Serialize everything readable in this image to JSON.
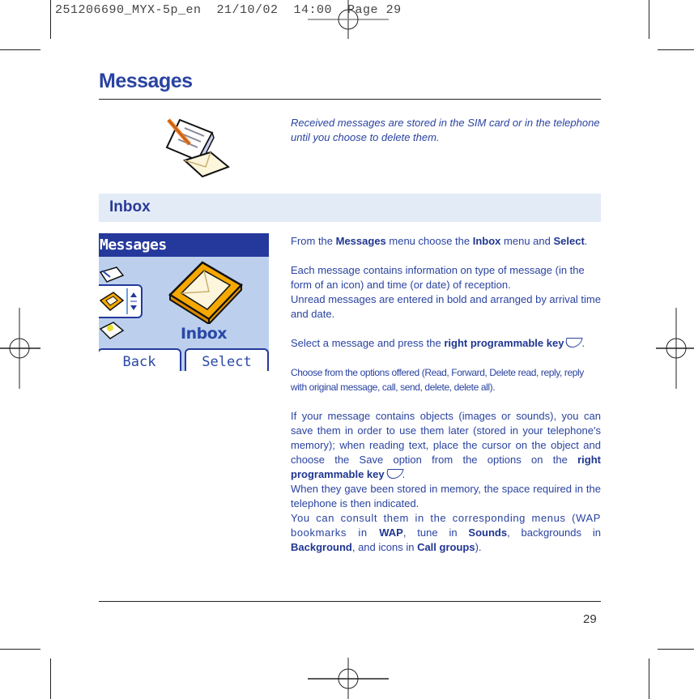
{
  "slug": "251206690_MYX-5p_en  21/10/02  14:00  Page 29",
  "page_title": "Messages",
  "intro": "Received messages are stored in the SIM card or in the telephone until you choose to delete them.",
  "section": "Inbox",
  "phone_screen": {
    "header": "Messages",
    "selected_label": "Inbox",
    "softkeys": {
      "left": "Back",
      "right": "Select"
    }
  },
  "body": {
    "p1": {
      "a": "From the ",
      "b1": "Messages",
      "c": " menu choose the ",
      "b2": "Inbox",
      "d": " menu and ",
      "b3": "Select",
      "e": "."
    },
    "p2a": "Each message contains information on type of message (in the form of an icon) and time (or date) of reception.",
    "p2b": "Unread messages are entered in bold and arranged by arrival time and date.",
    "p3": {
      "a": "Select a message and press the ",
      "b": "right programmable key",
      "c": "."
    },
    "p4": "Choose from the options offered (Read, Forward, Delete read, reply, reply with original message, call, send, delete, delete all).",
    "p5": {
      "a": "If your message contains objects (images or sounds), you can save them in order to use them later (stored in your telephone's memory); when reading text, place the cursor on the object and choose the Save option from the options on the ",
      "b": "right programmable key",
      "c": "."
    },
    "p6": "When they gave been stored in memory, the space required in the telephone is then indicated.",
    "p7": {
      "a": "You can consult them in the corresponding menus (WAP bookmarks in ",
      "b1": "WAP",
      "c": ", tune in ",
      "b2": "Sounds",
      "d": ", backgrounds in ",
      "b3": "Background",
      "e": ", and icons in ",
      "b4": "Call groups",
      "f": ")."
    }
  },
  "page_number": "29",
  "colors": {
    "text_blue": "#2a43a0",
    "band": "#e3ebf7",
    "phone_bg": "#bcd0ee",
    "phone_header": "#25389b",
    "inbox_orange": "#f5a800"
  }
}
